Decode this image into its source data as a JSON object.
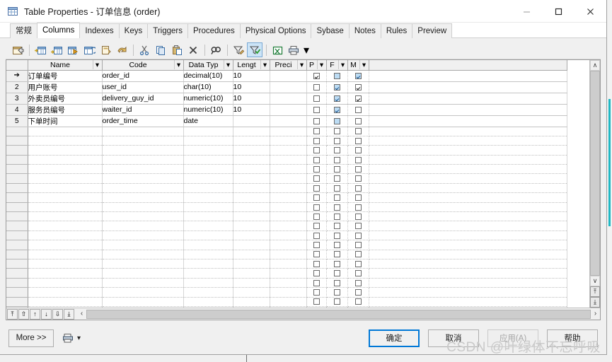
{
  "window": {
    "title": "Table Properties - 订单信息 (order)",
    "icon": "table-icon",
    "minimize_label": "—",
    "maximize_label": "❑",
    "close_label": "✕"
  },
  "tabs": [
    {
      "label": "常规",
      "active": false
    },
    {
      "label": "Columns",
      "active": true
    },
    {
      "label": "Indexes",
      "active": false
    },
    {
      "label": "Keys",
      "active": false
    },
    {
      "label": "Triggers",
      "active": false
    },
    {
      "label": "Procedures",
      "active": false
    },
    {
      "label": "Physical Options",
      "active": false
    },
    {
      "label": "Sybase",
      "active": false
    },
    {
      "label": "Notes",
      "active": false
    },
    {
      "label": "Rules",
      "active": false
    },
    {
      "label": "Preview",
      "active": false
    }
  ],
  "toolbar": {
    "items": [
      {
        "name": "properties-icon",
        "active": false
      },
      {
        "name": "insert-row-icon",
        "active": false
      },
      {
        "name": "add-row-icon",
        "active": false
      },
      {
        "name": "add-column-icon",
        "active": false
      },
      {
        "name": "replace-column-icon",
        "active": false
      },
      {
        "name": "duplicate-icon",
        "active": false
      },
      {
        "name": "undo-icon",
        "active": false
      },
      {
        "name": "cut-icon",
        "active": false
      },
      {
        "name": "copy-icon",
        "active": false
      },
      {
        "name": "paste-icon",
        "active": false
      },
      {
        "name": "delete-icon",
        "active": false
      },
      {
        "name": "find-icon",
        "active": false
      },
      {
        "name": "edit-filter-icon",
        "active": false
      },
      {
        "name": "apply-filter-icon",
        "active": true
      },
      {
        "name": "export-excel-icon",
        "active": false
      },
      {
        "name": "print-icon",
        "active": false
      }
    ],
    "caret": "▾"
  },
  "grid": {
    "columns": [
      {
        "key": "name",
        "label": "Name"
      },
      {
        "key": "code",
        "label": "Code"
      },
      {
        "key": "datatype",
        "label": "Data Typ"
      },
      {
        "key": "length",
        "label": "Lengt"
      },
      {
        "key": "precision",
        "label": "Preci"
      },
      {
        "key": "p",
        "label": "P"
      },
      {
        "key": "f",
        "label": "F"
      },
      {
        "key": "m",
        "label": "M"
      }
    ],
    "header_caret": "▾",
    "current_row_marker": "➔",
    "rows": [
      {
        "num": "",
        "marker": true,
        "name": "订单编号",
        "code": "order_id",
        "datatype": "decimal(10)",
        "length": "10",
        "precision": "",
        "p": {
          "checked": true,
          "highlight": false
        },
        "f": {
          "checked": false,
          "highlight": true
        },
        "m": {
          "checked": true,
          "highlight": true
        }
      },
      {
        "num": "2",
        "marker": false,
        "name": "用户账号",
        "code": "user_id",
        "datatype": "char(10)",
        "length": "10",
        "precision": "",
        "p": {
          "checked": false,
          "highlight": false
        },
        "f": {
          "checked": true,
          "highlight": true
        },
        "m": {
          "checked": true,
          "highlight": false
        }
      },
      {
        "num": "3",
        "marker": false,
        "name": "外卖员编号",
        "code": "delivery_guy_id",
        "datatype": "numeric(10)",
        "length": "10",
        "precision": "",
        "p": {
          "checked": false,
          "highlight": false
        },
        "f": {
          "checked": true,
          "highlight": true
        },
        "m": {
          "checked": true,
          "highlight": false
        }
      },
      {
        "num": "4",
        "marker": false,
        "name": "服务员编号",
        "code": "waiter_id",
        "datatype": "numeric(10)",
        "length": "10",
        "precision": "",
        "p": {
          "checked": false,
          "highlight": false
        },
        "f": {
          "checked": true,
          "highlight": true
        },
        "m": {
          "checked": false,
          "highlight": false
        }
      },
      {
        "num": "5",
        "marker": false,
        "name": "下单时间",
        "code": "order_time",
        "datatype": "date",
        "length": "",
        "precision": "",
        "p": {
          "checked": false,
          "highlight": false
        },
        "f": {
          "checked": false,
          "highlight": true
        },
        "m": {
          "checked": false,
          "highlight": false
        }
      }
    ],
    "empty_row_count": 21,
    "nav_buttons": [
      {
        "name": "move-to-top-button",
        "glyph": "⤒"
      },
      {
        "name": "move-up-all-button",
        "glyph": "⇧"
      },
      {
        "name": "move-up-button",
        "glyph": "↑"
      },
      {
        "name": "move-down-button",
        "glyph": "↓"
      },
      {
        "name": "move-down-all-button",
        "glyph": "⇩"
      },
      {
        "name": "move-to-bottom-button",
        "glyph": "⤓"
      }
    ],
    "scroll": {
      "up_arrow": "∧",
      "down_arrow": "∨",
      "left_arrow": "‹",
      "right_arrow": "›",
      "page_up_glyph": "⤒",
      "page_down_glyph": "⤓"
    }
  },
  "footer": {
    "more_label": "More >>",
    "save_icon": "save-icon",
    "save_caret": "▾",
    "ok_label": "确定",
    "cancel_label": "取消",
    "apply_label": "应用(A)",
    "help_label": "帮助"
  },
  "watermark": "CSDN @叶绿体不忘呼吸",
  "colors": {
    "accent": "#0078d7",
    "highlight_checkbox": "#bcdcf4",
    "toolbar_active": "#cce4f7",
    "dialog_bg": "#f0f0f0",
    "teal_strip": "#1fb8c4"
  }
}
